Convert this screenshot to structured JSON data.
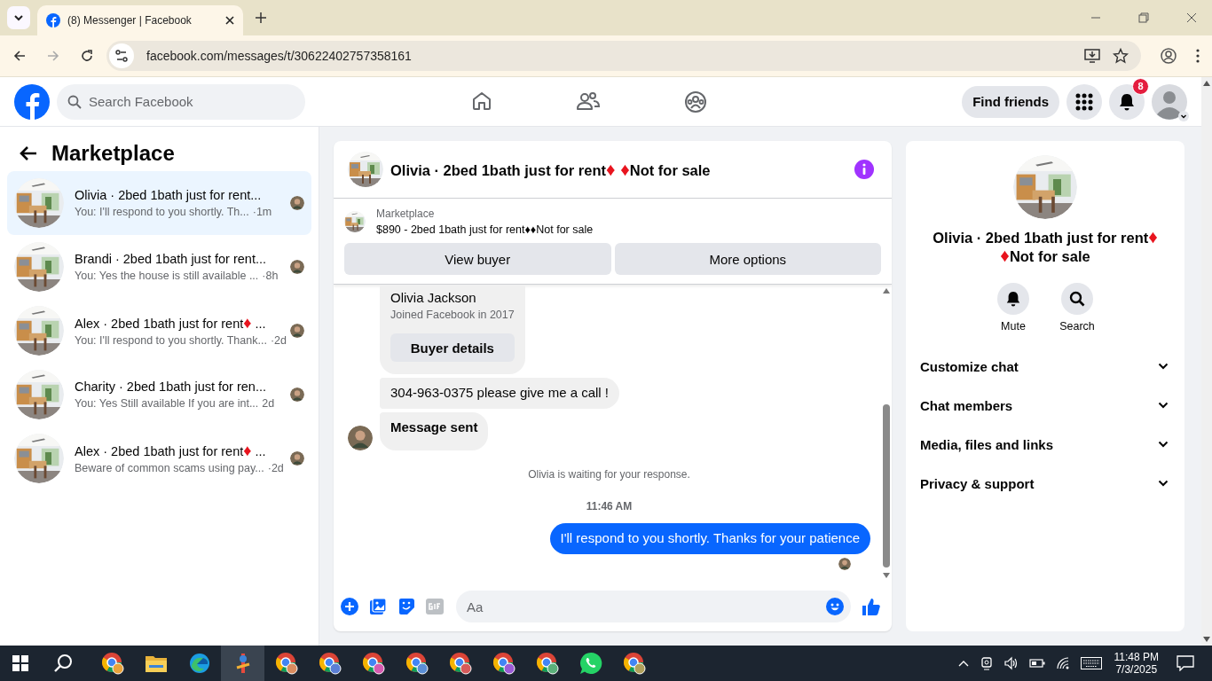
{
  "browser": {
    "tab_title": "(8) Messenger | Facebook",
    "url": "facebook.com/messages/t/30622402757358161"
  },
  "topbar": {
    "search": {
      "placeholder": "Search Facebook"
    },
    "find_friends": "Find friends",
    "notifications_badge": "8"
  },
  "sidebar": {
    "title": "Marketplace",
    "conversations": [
      {
        "parts": [
          {
            "text": "Olivia · 2bed 1bath just for rent...",
            "kind": "text"
          }
        ],
        "preview": "You: I'll respond to you shortly. Th...",
        "time": "·1m",
        "selected": true
      },
      {
        "parts": [
          {
            "text": "Brandi · 2bed 1bath just for rent...",
            "kind": "text"
          }
        ],
        "preview": "You: Yes the house is still available ...",
        "time": "·8h",
        "selected": false
      },
      {
        "parts": [
          {
            "text": "Alex · 2bed 1bath just for rent",
            "kind": "text"
          },
          {
            "text": "♦",
            "kind": "diamond"
          },
          {
            "text": " ...",
            "kind": "text"
          }
        ],
        "preview": "You: I'll respond to you shortly. Thank...",
        "time": "·2d",
        "selected": false
      },
      {
        "parts": [
          {
            "text": "Charity · 2bed 1bath just for ren...",
            "kind": "text"
          }
        ],
        "preview": "You: Yes Still available If you are int...",
        "time": "2d",
        "selected": false
      },
      {
        "parts": [
          {
            "text": "Alex · 2bed 1bath just for rent",
            "kind": "text"
          },
          {
            "text": "♦",
            "kind": "diamond"
          },
          {
            "text": " ...",
            "kind": "text"
          }
        ],
        "preview": "Beware of common scams using pay...",
        "time": "·2d",
        "selected": false
      }
    ]
  },
  "chat": {
    "title_parts": [
      {
        "text": "Olivia · 2bed 1bath just for rent",
        "kind": "text"
      },
      {
        "text": "♦ ♦",
        "kind": "diamond"
      },
      {
        "text": "Not for sale",
        "kind": "text"
      }
    ],
    "listing": {
      "label": "Marketplace",
      "text": "$890 - 2bed 1bath just for rent♦♦Not for sale",
      "buttons": [
        "View buyer",
        "More options"
      ]
    },
    "messages": [
      {
        "kind": "card",
        "name": "Olivia Jackson",
        "subtitle": "Joined Facebook in 2017",
        "button": "Buyer details"
      },
      {
        "kind": "incoming",
        "text": "304-963-0375 please give me a call !",
        "avatar": false,
        "bold": false
      },
      {
        "kind": "incoming",
        "text": "Message sent",
        "avatar": true,
        "bold": true
      },
      {
        "kind": "system",
        "text": "Olivia is waiting for your response."
      },
      {
        "kind": "time",
        "text": "11:46 AM"
      },
      {
        "kind": "outgoing",
        "text": "I'll respond to you shortly. Thanks for your patience"
      }
    ],
    "composer": {
      "placeholder": "Aa"
    }
  },
  "details": {
    "title_parts": [
      {
        "text": "Olivia · 2bed 1bath just for rent",
        "kind": "text"
      },
      {
        "text": "♦ ♦",
        "kind": "diamond"
      },
      {
        "text": "Not for sale",
        "kind": "text"
      }
    ],
    "actions": [
      {
        "label": "Mute",
        "kind": "bell"
      },
      {
        "label": "Search",
        "kind": "search"
      }
    ],
    "sections": [
      {
        "label": "Customize chat",
        "expanded": false
      },
      {
        "label": "Chat members",
        "expanded": false
      },
      {
        "label": "Media, files and links",
        "expanded": false
      },
      {
        "label": "Privacy & support",
        "expanded": false
      }
    ]
  },
  "taskbar": {
    "apps": [
      {
        "kind": "browser",
        "color": "#e8a33c",
        "selected": false
      },
      {
        "kind": "folder",
        "selected": false
      },
      {
        "kind": "edge",
        "selected": false
      },
      {
        "kind": "tool",
        "selected": true
      },
      {
        "kind": "browser",
        "color": "#d98c5f",
        "selected": false
      },
      {
        "kind": "browser",
        "color": "#5b7fd6",
        "selected": false
      },
      {
        "kind": "browser",
        "color": "#d65bb0",
        "selected": false
      },
      {
        "kind": "browser",
        "color": "#5b8fd6",
        "selected": false
      },
      {
        "kind": "browser",
        "color": "#d65b5b",
        "selected": false
      },
      {
        "kind": "browser",
        "color": "#9b5bd6",
        "selected": false
      },
      {
        "kind": "browser",
        "color": "#5bb07a",
        "selected": false
      },
      {
        "kind": "chat",
        "selected": false
      },
      {
        "kind": "browser",
        "color": "#b0a05b",
        "selected": false
      }
    ],
    "time": "11:48 PM",
    "date": "7/3/2025"
  }
}
